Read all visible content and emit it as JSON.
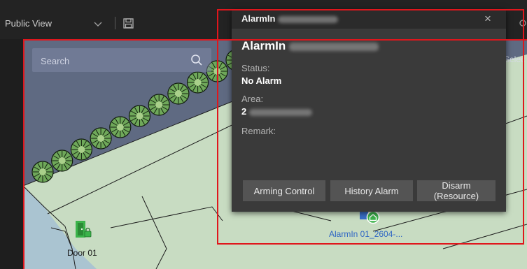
{
  "toolbar": {
    "view_name": "Public View",
    "view_dropdown_icon": "chevron-down-icon",
    "save_icon": "save-icon"
  },
  "map": {
    "search_placeholder": "Search",
    "search_icon": "search-icon",
    "select_hint": "Selec",
    "door": {
      "label": "Door 01",
      "icon": "door-icon"
    },
    "alarm_input": {
      "label": "AlarmIn 01_2604-...",
      "icon": "alarm-input-icon"
    }
  },
  "popup": {
    "header_title": "AlarmIn",
    "name": "AlarmIn",
    "status_label": "Status:",
    "status_value": "No Alarm",
    "area_label": "Area:",
    "area_value": "2",
    "remark_label": "Remark:",
    "close_label": "×",
    "buttons": {
      "arming_control": "Arming Control",
      "history_alarm": "History Alarm",
      "disarm": "Disarm (Resource)"
    }
  },
  "colors": {
    "highlight_frame": "#e0161c",
    "popup_bg": "#3a3a3a",
    "alarm_label": "#2f66c4",
    "door_icon": "#3bb34a"
  }
}
